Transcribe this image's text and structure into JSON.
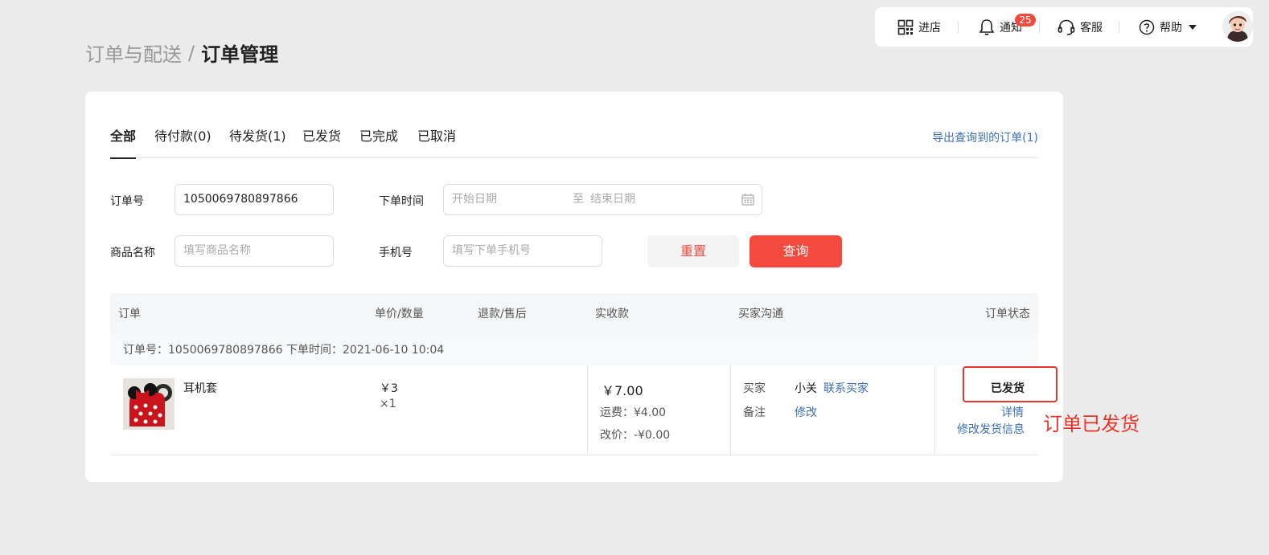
{
  "topbar": {
    "store_label": "进店",
    "notify_label": "通知",
    "notify_count": "25",
    "service_label": "客服",
    "help_label": "帮助"
  },
  "breadcrumb": {
    "parent": "订单与配送",
    "separator": "/",
    "current": "订单管理"
  },
  "tabs": [
    {
      "label": "全部",
      "active": true
    },
    {
      "label": "待付款(0)"
    },
    {
      "label": "待发货(1)"
    },
    {
      "label": "已发货"
    },
    {
      "label": "已完成"
    },
    {
      "label": "已取消"
    }
  ],
  "export_label": "导出查询到的订单(1)",
  "filters": {
    "order_no_label": "订单号",
    "order_no_value": "1050069780897866",
    "order_time_label": "下单时间",
    "start_placeholder": "开始日期",
    "range_sep": "至",
    "end_placeholder": "结束日期",
    "product_label": "商品名称",
    "product_placeholder": "填写商品名称",
    "phone_label": "手机号",
    "phone_placeholder": "填写下单手机号",
    "reset_label": "重置",
    "query_label": "查询"
  },
  "table": {
    "headers": [
      "订单",
      "单价/数量",
      "退款/售后",
      "实收款",
      "买家沟通",
      "订单状态"
    ]
  },
  "order": {
    "meta_no": "订单号：1050069780897866",
    "meta_time": "下单时间：2021-06-10 10:04",
    "product_name": "耳机套",
    "price": "￥3",
    "qty": "×1",
    "amount": "￥7.00",
    "shipping": "运费：¥4.00",
    "adjust": "改价：-¥0.00",
    "buyer_label": "买家",
    "buyer_name": "小关",
    "contact_label": "联系买家",
    "note_label": "备注",
    "modify_label": "修改",
    "status": "已发货",
    "detail_label": "详情",
    "modify_ship_label": "修改发货信息"
  },
  "annotation": "订单已发货",
  "colors": {
    "accent": "#f4493f",
    "link": "#3b6fb6",
    "annotation": "#e8342b"
  }
}
